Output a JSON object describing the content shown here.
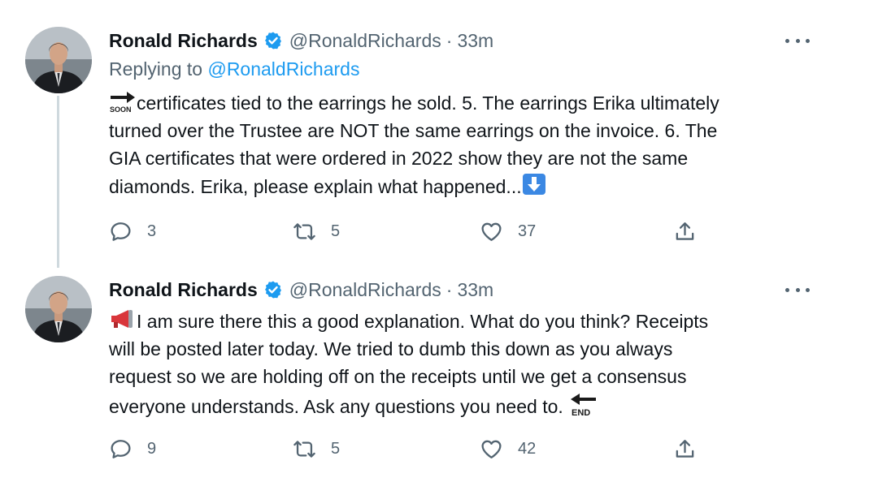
{
  "tweets": [
    {
      "name": "Ronald Richards",
      "handle": "@RonaldRichards",
      "separator": "·",
      "time": "33m",
      "replying_label": "Replying to",
      "replying_handle": "@RonaldRichards",
      "lead_emoji": "soon-arrow-icon",
      "lead_emoji_text": "SOON",
      "lines": [
        "certificates tied to the earrings he sold.  5. The earrings Erika ultimately",
        "turned over the Trustee are NOT the same earrings on the invoice. 6. The",
        "GIA certificates that were ordered in 2022 show they are not the same",
        "diamonds.  Erika, please explain what happened..."
      ],
      "trail_emoji": "down-arrow-button-icon",
      "replies": "3",
      "retweets": "5",
      "likes": "37"
    },
    {
      "name": "Ronald Richards",
      "handle": "@RonaldRichards",
      "separator": "·",
      "time": "33m",
      "lead_emoji": "megaphone-icon",
      "lines": [
        "I am sure there this a good explanation.  What do you think? Receipts",
        "will be posted later today.  We tried to dumb this down as you always",
        "request so we are holding off on the receipts until we get a consensus",
        "everyone understands.  Ask any questions you need to. "
      ],
      "trail_emoji": "end-arrow-icon",
      "trail_emoji_text": "END",
      "replies": "9",
      "retweets": "5",
      "likes": "42"
    }
  ],
  "colors": {
    "text": "#0f1419",
    "secondary": "#536471",
    "link": "#1d9bf0",
    "verified": "#1d9bf0",
    "thread_line": "#cfd9de"
  },
  "icons": {
    "reply": "reply-icon",
    "retweet": "retweet-icon",
    "like": "heart-icon",
    "share": "share-icon",
    "more": "more-icon",
    "verified": "verified-badge-icon"
  }
}
